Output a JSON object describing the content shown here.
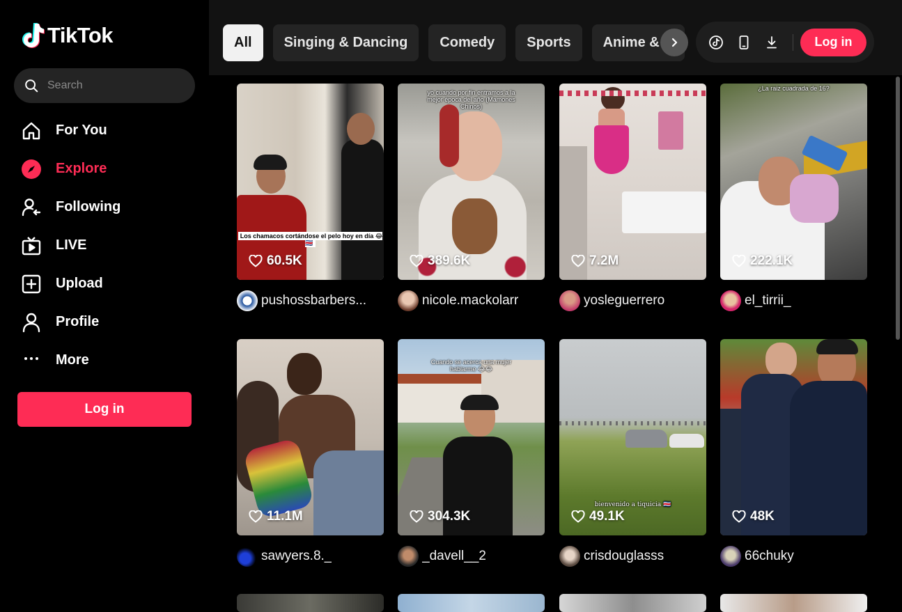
{
  "brand": {
    "name": "TikTok",
    "accent": "#fe2c55"
  },
  "search": {
    "placeholder": "Search"
  },
  "nav": [
    {
      "label": "For You",
      "icon": "home-icon"
    },
    {
      "label": "Explore",
      "icon": "compass-icon",
      "active": true
    },
    {
      "label": "Following",
      "icon": "following-icon"
    },
    {
      "label": "LIVE",
      "icon": "live-icon"
    },
    {
      "label": "Upload",
      "icon": "upload-icon"
    },
    {
      "label": "Profile",
      "icon": "profile-icon"
    },
    {
      "label": "More",
      "icon": "more-icon"
    }
  ],
  "sidebar_login": "Log in",
  "categories": [
    "All",
    "Singing & Dancing",
    "Comedy",
    "Sports",
    "Anime & C"
  ],
  "topbar": {
    "login": "Log in"
  },
  "videos": [
    {
      "likes": "60.5K",
      "author": "pushossbarbers...",
      "caption": "Los chamacos cortándose el pelo hoy en día 😂🇨🇷"
    },
    {
      "likes": "389.6K",
      "author": "nicole.mackolarr",
      "caption": "yo cuando por fin entramos a la mejor época del año (Mamones Chinos)"
    },
    {
      "likes": "7.2M",
      "author": "yosleguerrero",
      "caption": ""
    },
    {
      "likes": "222.1K",
      "author": "el_tirrii_",
      "caption": "¿La raiz cuadrada de 16?"
    },
    {
      "likes": "11.1M",
      "author": "sawyers.8._",
      "caption": ""
    },
    {
      "likes": "304.3K",
      "author": "_davell__2",
      "caption": "Cuando se acerca una mujer hablarme 😂😂"
    },
    {
      "likes": "49.1K",
      "author": "crisdouglasss",
      "caption": "bienvenido a tiquicia 🇨🇷"
    },
    {
      "likes": "48K",
      "author": "66chuky",
      "caption": ""
    }
  ]
}
